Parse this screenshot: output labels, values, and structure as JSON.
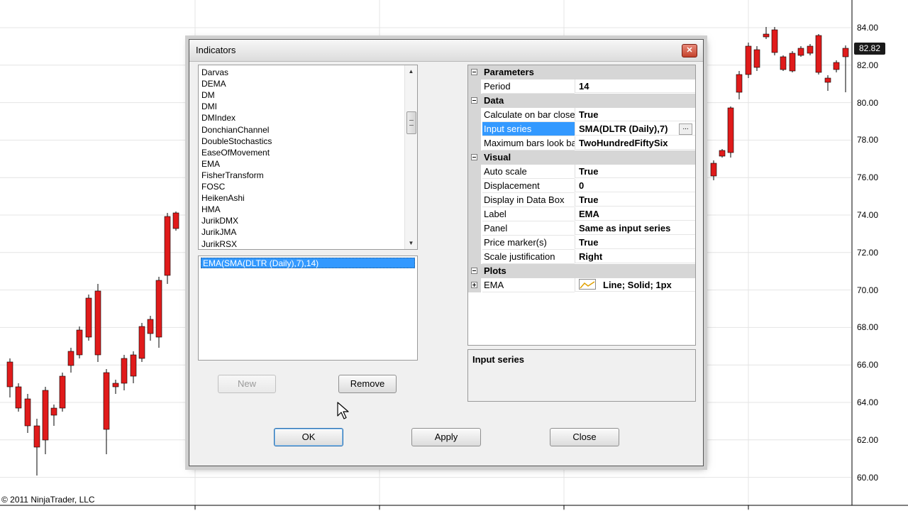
{
  "chart": {
    "price_axis": [
      "84.00",
      "82.00",
      "80.00",
      "78.00",
      "76.00",
      "74.00",
      "72.00",
      "70.00",
      "68.00",
      "66.00",
      "64.00",
      "62.00",
      "60.00"
    ],
    "last_price": "82.82",
    "copyright": "© 2011 NinjaTrader, LLC",
    "colors": {
      "up": "#22dd22",
      "down": "#e01b1b",
      "wick": "#000000",
      "grid": "#e4e4e4"
    }
  },
  "dialog": {
    "title": "Indicators",
    "indicator_list": [
      "Darvas",
      "DEMA",
      "DM",
      "DMI",
      "DMIndex",
      "DonchianChannel",
      "DoubleStochastics",
      "EaseOfMovement",
      "EMA",
      "FisherTransform",
      "FOSC",
      "HeikenAshi",
      "HMA",
      "JurikDMX",
      "JurikJMA",
      "JurikRSX"
    ],
    "applied_indicators": [
      "EMA(SMA(DLTR (Daily),7),14)"
    ],
    "properties": {
      "categories": [
        {
          "label": "Parameters",
          "rows": [
            {
              "name": "Period",
              "value": "14"
            }
          ]
        },
        {
          "label": "Data",
          "rows": [
            {
              "name": "Calculate on bar close",
              "value": "True"
            },
            {
              "name": "Input series",
              "value": "SMA(DLTR (Daily),7)",
              "selected": true
            },
            {
              "name": "Maximum bars look back",
              "value": "TwoHundredFiftySix"
            }
          ]
        },
        {
          "label": "Visual",
          "rows": [
            {
              "name": "Auto scale",
              "value": "True"
            },
            {
              "name": "Displacement",
              "value": "0"
            },
            {
              "name": "Display in Data Box",
              "value": "True"
            },
            {
              "name": "Label",
              "value": "EMA"
            },
            {
              "name": "Panel",
              "value": "Same as input series"
            },
            {
              "name": "Price marker(s)",
              "value": "True"
            },
            {
              "name": "Scale justification",
              "value": "Right"
            }
          ]
        },
        {
          "label": "Plots",
          "rows": [
            {
              "name": "EMA",
              "value": "Line; Solid; 1px"
            }
          ]
        }
      ],
      "ellipsis": "..."
    },
    "description_title": "Input series",
    "buttons": {
      "new": "New",
      "remove": "Remove",
      "ok": "OK",
      "apply": "Apply",
      "close": "Close"
    },
    "close_glyph": "✕"
  }
}
